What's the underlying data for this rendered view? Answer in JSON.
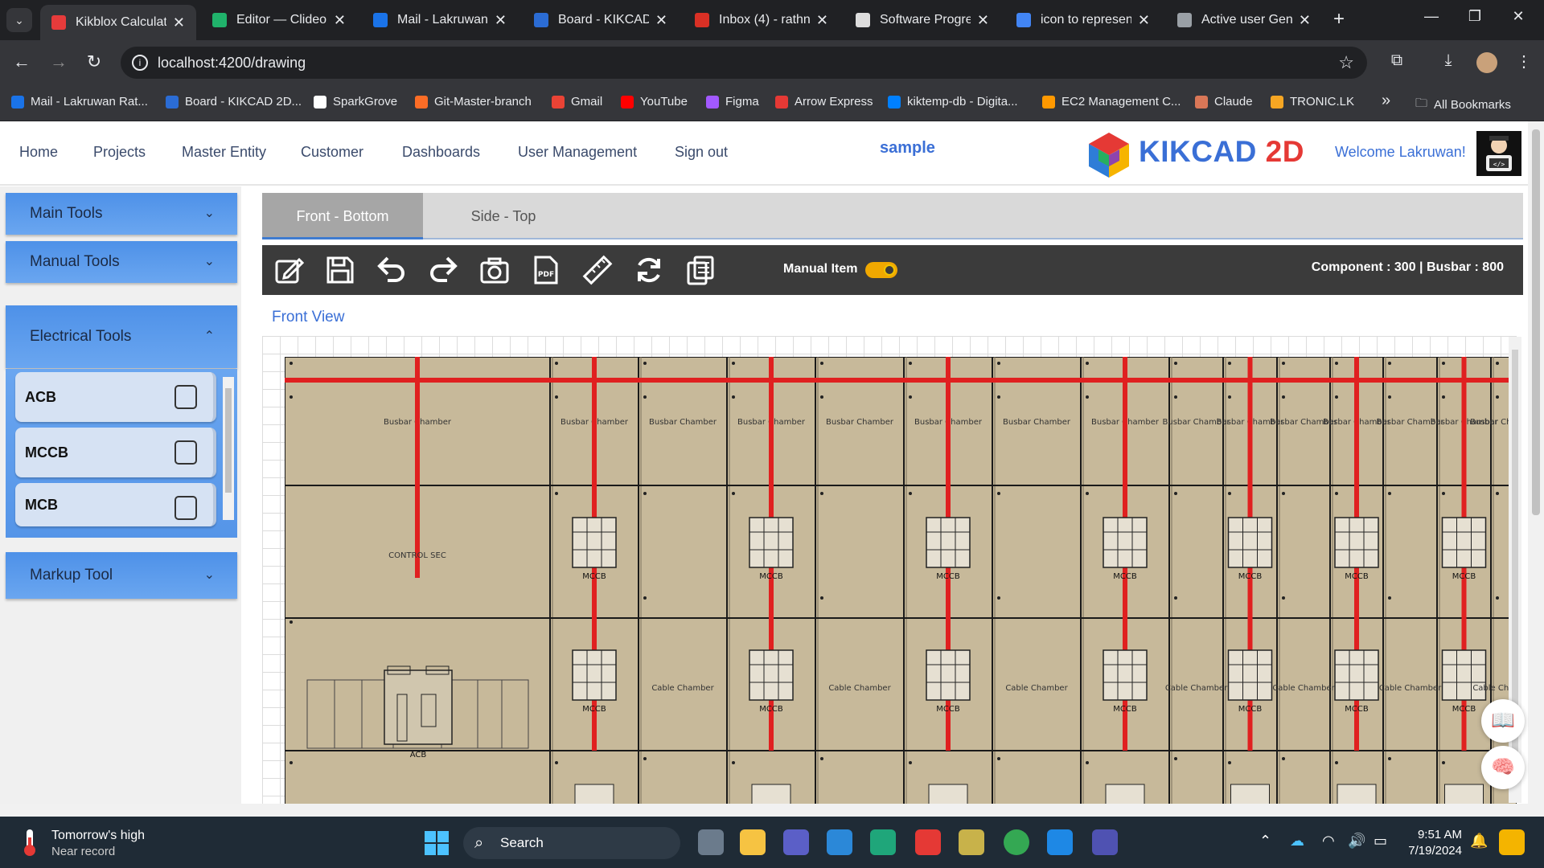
{
  "browser": {
    "tabs": [
      {
        "title": "Kikblox Calculato",
        "active": true,
        "color": "#e63b3b"
      },
      {
        "title": "Editor — Clideo",
        "color": "#20b26b"
      },
      {
        "title": "Mail - Lakruwan",
        "color": "#1a73e8"
      },
      {
        "title": "Board - KIKCAD",
        "color": "#2b6cd4"
      },
      {
        "title": "Inbox (4) - rathn",
        "color": "#d93025"
      },
      {
        "title": "Software Progre",
        "color": "#dddddd"
      },
      {
        "title": "icon to represen",
        "color": "#4285f4"
      },
      {
        "title": "Active user Gene",
        "color": "#9aa0a6"
      }
    ],
    "url": "localhost:4200/drawing",
    "bookmarks": [
      {
        "label": "Mail - Lakruwan Rat...",
        "color": "#1a73e8"
      },
      {
        "label": "Board - KIKCAD 2D...",
        "color": "#2b6cd4"
      },
      {
        "label": "SparkGrove",
        "color": "#ffffff"
      },
      {
        "label": "Git-Master-branch",
        "color": "#fc6d26"
      },
      {
        "label": "Gmail",
        "color": "#ea4335"
      },
      {
        "label": "YouTube",
        "color": "#ff0000"
      },
      {
        "label": "Figma",
        "color": "#a259ff"
      },
      {
        "label": "Arrow Express",
        "color": "#e53935"
      },
      {
        "label": "kiktemp-db - Digita...",
        "color": "#0080ff"
      },
      {
        "label": "EC2 Management C...",
        "color": "#ff9900"
      },
      {
        "label": "Claude",
        "color": "#d97757"
      },
      {
        "label": "TRONIC.LK",
        "color": "#f6a623"
      }
    ],
    "more": "»",
    "all_bookmarks": "All Bookmarks"
  },
  "header": {
    "nav": [
      "Home",
      "Projects",
      "Master Entity",
      "Customer",
      "Dashboards",
      "User Management",
      "Sign out"
    ],
    "project": "sample",
    "logo_main": "KIKCAD",
    "logo_accent": "2D",
    "welcome": "Welcome Lakruwan!"
  },
  "sidebar": {
    "main_tools": "Main Tools",
    "manual_tools": "Manual Tools",
    "electrical_tools": "Electrical Tools",
    "items": [
      "ACB",
      "MCCB",
      "MCB"
    ],
    "markup_tool": "Markup Tool"
  },
  "workspace": {
    "tabs": [
      "Front - Bottom",
      "Side - Top"
    ],
    "active_tab": "Front - Bottom",
    "manual_item_label": "Manual Item",
    "manual_item_on": true,
    "counts": "Component : 300 | Busbar : 800",
    "view_title": "Front View",
    "toolbar_icons": [
      "edit-icon",
      "save-icon",
      "undo-icon",
      "redo-icon",
      "camera-icon",
      "pdf-icon",
      "ruler-icon",
      "refresh-icon",
      "calculator-icon"
    ]
  },
  "drawing": {
    "labels": {
      "busbar": "Busbar Chamber",
      "cable": "Cable Chamber",
      "control": "CONTROL SEC",
      "mccb": "MCCB",
      "acb": "ACB"
    },
    "colors": {
      "panel": "#c7b99a",
      "busbar": "#e02020",
      "line": "#1a1a1a"
    }
  },
  "taskbar": {
    "weather_title": "Tomorrow's high",
    "weather_sub": "Near record",
    "search": "Search",
    "time": "9:51 AM",
    "date": "7/19/2024"
  }
}
